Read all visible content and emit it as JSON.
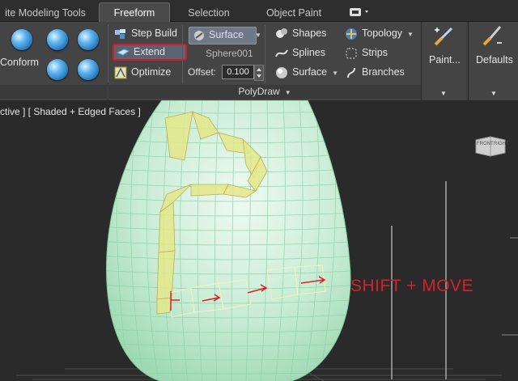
{
  "tabs": [
    "ite Modeling Tools",
    "Freeform",
    "Selection",
    "Object Paint"
  ],
  "tabs_extra_icon": "panel-toggle-icon",
  "tools": {
    "conform": "Conform",
    "step_build": "Step Build",
    "extend": "Extend",
    "optimize": "Optimize",
    "surface_button": "Surface",
    "surface_object": "Sphere001",
    "offset_label": "Offset:",
    "offset_value": "0.100",
    "shapes": "Shapes",
    "splines": "Splines",
    "surface_dropdown": "Surface",
    "topology": "Topology",
    "strips": "Strips",
    "branches": "Branches",
    "paint": "Paint...",
    "defaults": "Defaults"
  },
  "group_label": "PolyDraw",
  "viewport": {
    "label": "ctive ] [ Shaded + Edged Faces ]",
    "annotation": "SHIFT + MOVE",
    "viewcube_left": "FRONT",
    "viewcube_right": "RIGHT"
  },
  "colors": {
    "ribbon": "#444444",
    "highlight": "#d9192b",
    "mesh": "#c8ecd4",
    "polydraw": "#e4e88a",
    "annotation": "#d2222c"
  }
}
